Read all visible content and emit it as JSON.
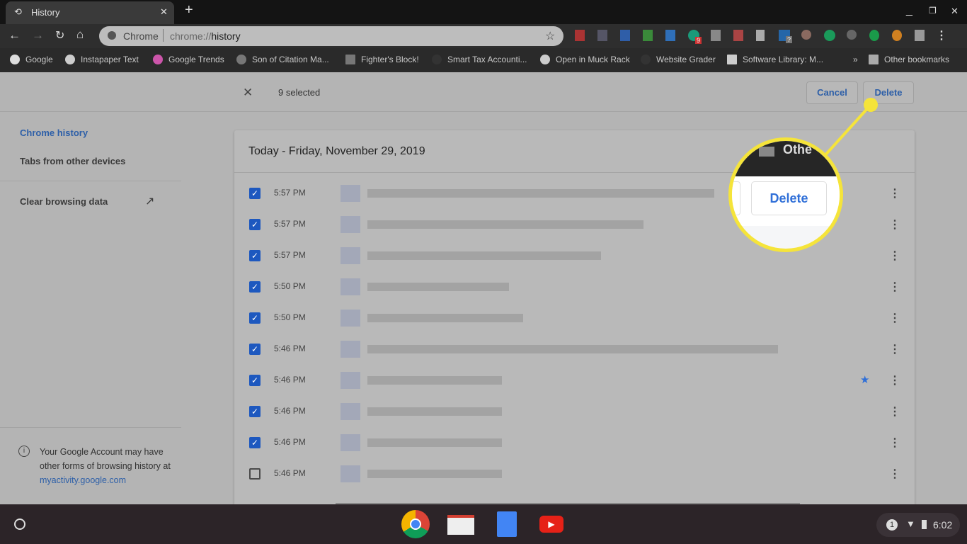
{
  "browser": {
    "tab_title": "History",
    "new_tab": "+",
    "omnibox_site": "Chrome",
    "omnibox_url_prefix": "chrome://",
    "omnibox_url_path": "history",
    "bookmarks": [
      "Google",
      "Instapaper Text",
      "Google Trends",
      "Son of Citation Ma...",
      "Fighter's Block!",
      "Smart Tax Accounti...",
      "Open in Muck Rack",
      "Website Grader",
      "Software Library: M..."
    ],
    "more_bookmarks": "»",
    "other_bookmarks": "Other bookmarks",
    "extension_badges": {
      "a": "9",
      "in": "?"
    }
  },
  "header": {
    "selected_count": "9 selected",
    "cancel_label": "Cancel",
    "delete_label": "Delete"
  },
  "sidebar": {
    "items": [
      "Chrome history",
      "Tabs from other devices",
      "Clear browsing data"
    ],
    "footer_text": "Your Google Account may have other forms of browsing history at ",
    "footer_link": "myactivity.google.com"
  },
  "history": {
    "date_heading": "Today - Friday, November 29, 2019",
    "rows": [
      {
        "time": "5:57 PM",
        "checked": true,
        "starred": false
      },
      {
        "time": "5:57 PM",
        "checked": true,
        "starred": false
      },
      {
        "time": "5:57 PM",
        "checked": true,
        "starred": false
      },
      {
        "time": "5:50 PM",
        "checked": true,
        "starred": false
      },
      {
        "time": "5:50 PM",
        "checked": true,
        "starred": false
      },
      {
        "time": "5:46 PM",
        "checked": true,
        "starred": false
      },
      {
        "time": "5:46 PM",
        "checked": true,
        "starred": true
      },
      {
        "time": "5:46 PM",
        "checked": true,
        "starred": false
      },
      {
        "time": "5:46 PM",
        "checked": true,
        "starred": false
      },
      {
        "time": "5:46 PM",
        "checked": false,
        "starred": false
      }
    ]
  },
  "callout": {
    "delete_label": "Delete",
    "partial_text": "Othe",
    "color": "#f5e43a"
  },
  "taskbar": {
    "notification_count": "1",
    "clock": "6:02"
  },
  "colors": {
    "accent": "#2d5fa8",
    "checkbox": "#1d58bf",
    "callout": "#f5e43a"
  }
}
